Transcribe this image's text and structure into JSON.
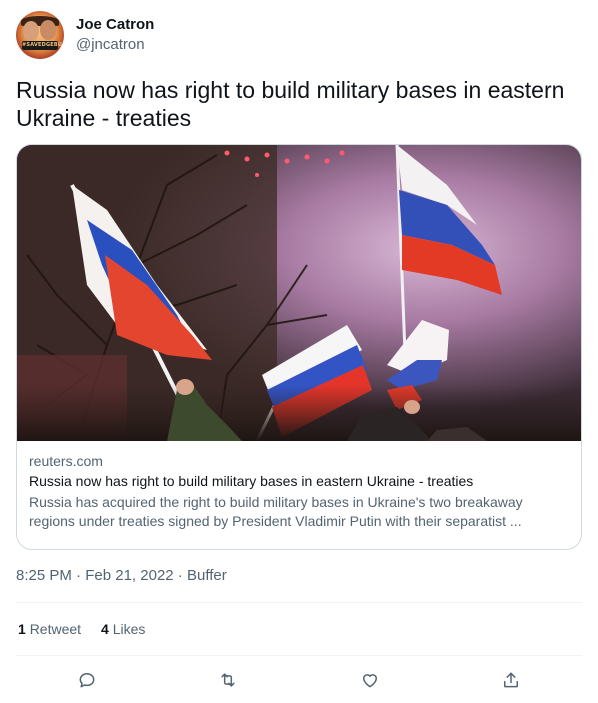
{
  "author": {
    "display_name": "Joe Catron",
    "handle": "@jncatron",
    "avatar_sign_text": "#SAVEDGEBURG"
  },
  "tweet": {
    "text": "Russia now has right to build military bases in eastern Ukraine - treaties"
  },
  "card": {
    "domain": "reuters.com",
    "title": "Russia now has right to build military bases in eastern Ukraine - treaties",
    "description": "Russia has acquired the right to build military bases in Ukraine's two breakaway regions under treaties signed by President Vladimir Putin with their separatist ...",
    "image_icon": "photo-flags-smoke"
  },
  "meta": {
    "time": "8:25 PM",
    "separator": "·",
    "date": "Feb 21, 2022",
    "source": "Buffer"
  },
  "stats": {
    "retweet_count": "1",
    "retweet_label": "Retweet",
    "like_count": "4",
    "like_label": "Likes"
  },
  "actions": [
    "reply-icon",
    "retweet-icon",
    "like-icon",
    "share-icon"
  ],
  "colors": {
    "text_primary": "#0f1419",
    "text_secondary": "#536471",
    "border": "#cfd9de",
    "divider": "#eff3f4"
  }
}
